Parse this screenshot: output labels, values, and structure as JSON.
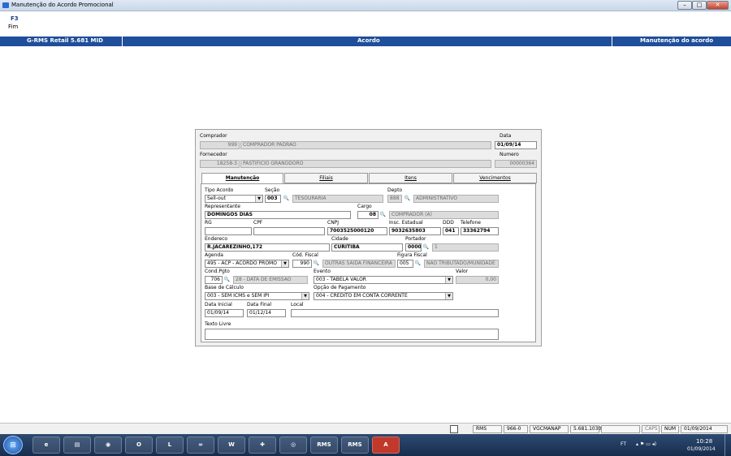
{
  "window": {
    "title": "Manutenção do Acordo Promocional",
    "btn_min": "–",
    "btn_max": "□",
    "btn_close": "✕"
  },
  "menu": {
    "key": "F3",
    "label": "Fim"
  },
  "header": {
    "left": "G-RMS Retail 5.681 MID",
    "center": "Acordo",
    "right": "Manutenção do acordo"
  },
  "form": {
    "comprador_label": "Comprador",
    "comprador_code": "999",
    "comprador_name": "COMPRADOR PADRAO",
    "data_label": "Data",
    "data_value": "01/09/14",
    "fornecedor_label": "Fornecedor",
    "fornecedor_code": "18258-3",
    "fornecedor_name": "PASTIFICIO GRANODORO",
    "numero_label": "Numero",
    "numero_value": "00000364"
  },
  "tabs": [
    "Manutenção",
    "Filiais",
    "Itens",
    "Vencimentos"
  ],
  "tab_form": {
    "tipo_acordo_label": "Tipo Acordo",
    "tipo_acordo_value": "Sell-out",
    "secao_label": "Seção",
    "secao_code": "003",
    "secao_name": "TESOURARIA",
    "depto_label": "Depto",
    "depto_code": "888",
    "depto_name": "ADMINISTRATIVO",
    "representante_label": "Representante",
    "representante_value": "DOMINGOS DIAS",
    "cargo_label": "Cargo",
    "cargo_code": "08",
    "cargo_name": "COMPRADOR (A)",
    "rg_label": "RG",
    "rg_value": "",
    "cpf_label": "CPF",
    "cpf_value": "",
    "cnpj_label": "CNPJ",
    "cnpj_value": "7003525000120",
    "insc_label": "Insc. Estadual",
    "insc_value": "9032635803",
    "ddd_label": "DDD",
    "ddd_value": "041",
    "telefone_label": "Telefone",
    "telefone_value": "33362794",
    "endereco_label": "Endereco",
    "endereco_value": "R.JACAREZINHO,172",
    "cidade_label": "Cidade",
    "cidade_value": "CURITIBA",
    "portador_label": "Portador",
    "portador_code": "0000",
    "portador_name": "1",
    "agenda_label": "Agenda",
    "agenda_value": "495 - ACP - ACORDO PROMO",
    "cod_fiscal_label": "Cód. Fiscal",
    "cod_fiscal_code": "990",
    "cod_fiscal_name": "OUTRAS SAIDA FINANCEIRA",
    "figura_fiscal_label": "Figura Fiscal",
    "figura_fiscal_code": "005",
    "figura_fiscal_name": "NAO TRIBUTADO/MUNIDADE",
    "cond_pgto_label": "Cond.Pgto",
    "cond_pgto_code": "706",
    "cond_pgto_name": "28 - DATA DE EMISSAO",
    "evento_label": "Evento",
    "evento_value": "003 - TABELA VALOR",
    "valor_label": "Valor",
    "valor_value": "0,00",
    "base_calculo_label": "Base de Cálculo",
    "base_calculo_value": "003 - SEM ICMS e SEM IPI",
    "opcao_pagamento_label": "Opção de Pagamento",
    "opcao_pagamento_value": "004 - CRÉDITO EM CONTA CORRENTE",
    "data_inicial_label": "Data Inicial",
    "data_inicial_value": "01/09/14",
    "data_final_label": "Data Final",
    "data_final_value": "01/12/14",
    "local_label": "Local",
    "local_value": "",
    "texto_livre_label": "Texto Livre",
    "texto_livre_value": ""
  },
  "status": {
    "app": "RMS",
    "code": "966-0",
    "server": "VGCMANAP",
    "version": "5.681.1030",
    "caps": "CAPS",
    "num": "NUM",
    "date": "01/09/2014"
  },
  "taskbar": {
    "rms1": "RMS",
    "rms2": "RMS",
    "tray_lang": "FT",
    "clock_time": "10:28",
    "clock_date": "01/09/2014"
  }
}
